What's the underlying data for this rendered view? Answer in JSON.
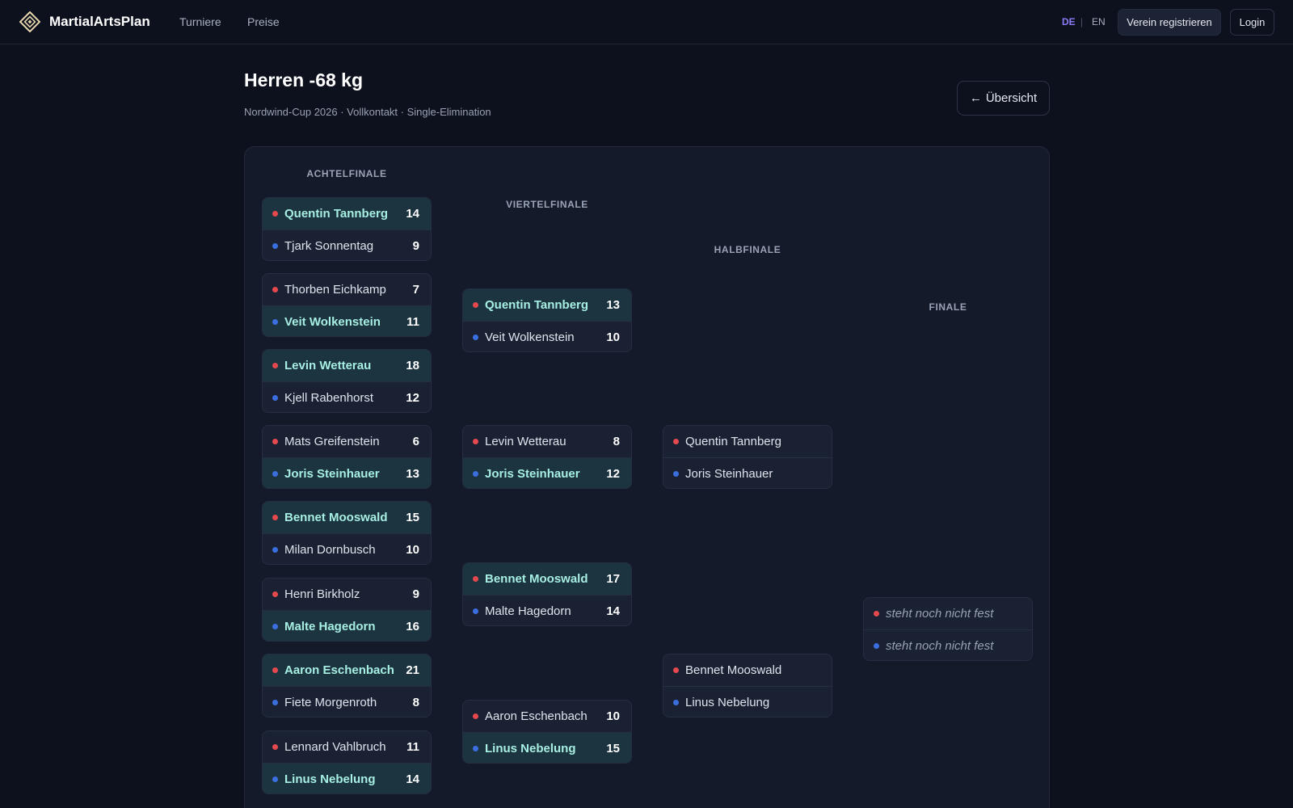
{
  "brand": {
    "name": "MartialArtsPlan"
  },
  "nav": {
    "turniere": "Turniere",
    "preise": "Preise"
  },
  "lang": {
    "de": "DE",
    "sep": "|",
    "en": "EN"
  },
  "header_actions": {
    "register": "Verein registrieren",
    "login": "Login"
  },
  "page": {
    "title": "Herren -68 kg",
    "subtitle": "Nordwind-Cup 2026 · Vollkontakt · Single-Elimination",
    "back_arrow": "←",
    "back_label": "Übersicht"
  },
  "colors": {
    "red_corner": "#e5484d",
    "blue_corner": "#3b6fe0",
    "winner_bg": "#1c3340",
    "accent": "#8b7cf6"
  },
  "rounds": [
    {
      "label": "ACHTELFINALE",
      "matches": [
        {
          "red": {
            "name": "Quentin Tannberg",
            "score": "14",
            "win": true
          },
          "blue": {
            "name": "Tjark Sonnentag",
            "score": "9",
            "win": false
          }
        },
        {
          "red": {
            "name": "Thorben Eichkamp",
            "score": "7",
            "win": false
          },
          "blue": {
            "name": "Veit Wolkenstein",
            "score": "11",
            "win": true
          }
        },
        {
          "red": {
            "name": "Levin Wetterau",
            "score": "18",
            "win": true
          },
          "blue": {
            "name": "Kjell Rabenhorst",
            "score": "12",
            "win": false
          }
        },
        {
          "red": {
            "name": "Mats Greifenstein",
            "score": "6",
            "win": false
          },
          "blue": {
            "name": "Joris Steinhauer",
            "score": "13",
            "win": true
          }
        },
        {
          "red": {
            "name": "Bennet Mooswald",
            "score": "15",
            "win": true
          },
          "blue": {
            "name": "Milan Dornbusch",
            "score": "10",
            "win": false
          }
        },
        {
          "red": {
            "name": "Henri Birkholz",
            "score": "9",
            "win": false
          },
          "blue": {
            "name": "Malte Hagedorn",
            "score": "16",
            "win": true
          }
        },
        {
          "red": {
            "name": "Aaron Eschenbach",
            "score": "21",
            "win": true
          },
          "blue": {
            "name": "Fiete Morgenroth",
            "score": "8",
            "win": false
          }
        },
        {
          "red": {
            "name": "Lennard Vahlbruch",
            "score": "11",
            "win": false
          },
          "blue": {
            "name": "Linus Nebelung",
            "score": "14",
            "win": true
          }
        }
      ]
    },
    {
      "label": "VIERTELFINALE",
      "matches": [
        {
          "red": {
            "name": "Quentin Tannberg",
            "score": "13",
            "win": true
          },
          "blue": {
            "name": "Veit Wolkenstein",
            "score": "10",
            "win": false
          }
        },
        {
          "red": {
            "name": "Levin Wetterau",
            "score": "8",
            "win": false
          },
          "blue": {
            "name": "Joris Steinhauer",
            "score": "12",
            "win": true
          }
        },
        {
          "red": {
            "name": "Bennet Mooswald",
            "score": "17",
            "win": true
          },
          "blue": {
            "name": "Malte Hagedorn",
            "score": "14",
            "win": false
          }
        },
        {
          "red": {
            "name": "Aaron Eschenbach",
            "score": "10",
            "win": false
          },
          "blue": {
            "name": "Linus Nebelung",
            "score": "15",
            "win": true
          }
        }
      ]
    },
    {
      "label": "HALBFINALE",
      "matches": [
        {
          "red": {
            "name": "Quentin Tannberg",
            "score": "",
            "win": false
          },
          "blue": {
            "name": "Joris Steinhauer",
            "score": "",
            "win": false
          }
        },
        {
          "red": {
            "name": "Bennet Mooswald",
            "score": "",
            "win": false
          },
          "blue": {
            "name": "Linus Nebelung",
            "score": "",
            "win": false
          }
        }
      ]
    },
    {
      "label": "FINALE",
      "matches": [
        {
          "red": {
            "name": "steht noch nicht fest",
            "score": "",
            "win": false,
            "tbd": true
          },
          "blue": {
            "name": "steht noch nicht fest",
            "score": "",
            "win": false,
            "tbd": true
          }
        }
      ]
    }
  ]
}
